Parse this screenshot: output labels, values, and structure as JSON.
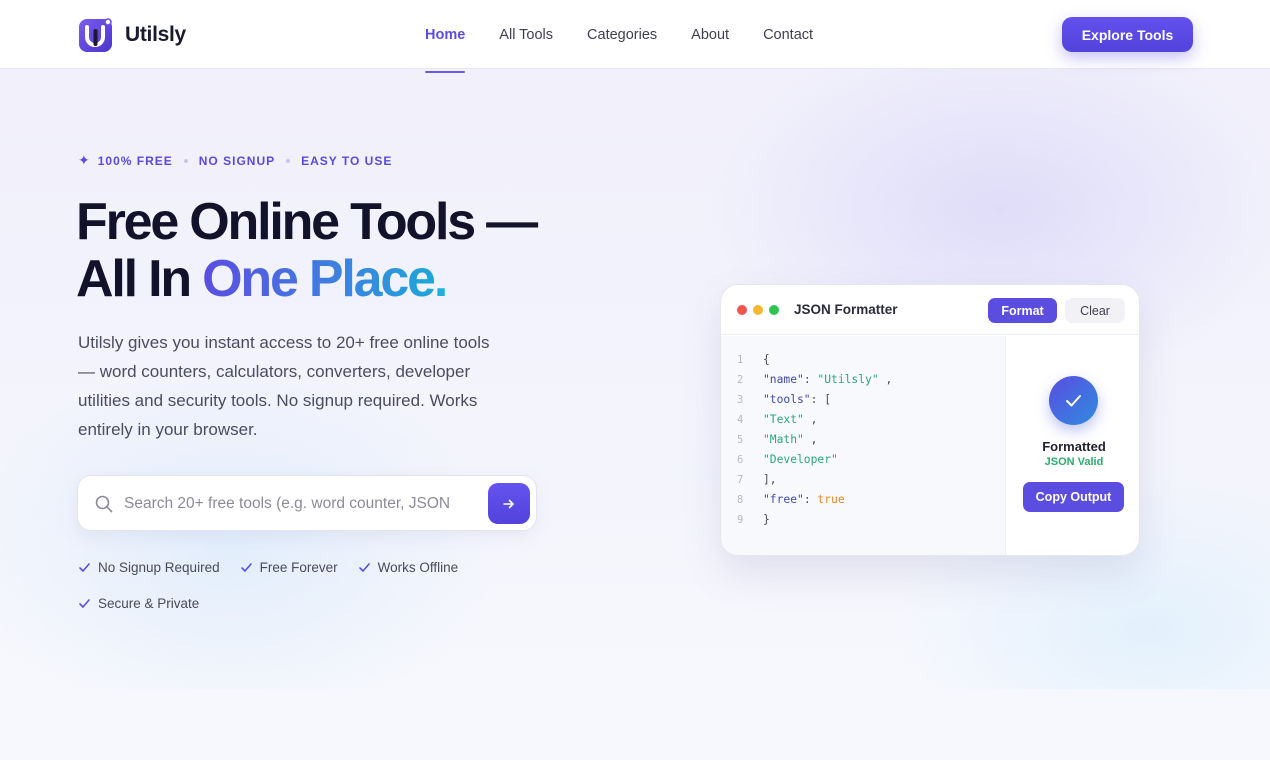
{
  "header": {
    "logo_text": "Utilsly",
    "nav": [
      {
        "label": "Home",
        "active": true
      },
      {
        "label": "All Tools"
      },
      {
        "label": "Categories"
      },
      {
        "label": "About"
      },
      {
        "label": "Contact"
      }
    ],
    "cta_label": "Explore Tools"
  },
  "hero": {
    "badges": [
      "100% FREE",
      "NO SIGNUP",
      "EASY TO USE"
    ],
    "title_line1": "Free Online Tools —",
    "title_line2_plain": "All In ",
    "title_line2_accent": "One Place",
    "title_line2_dot": ".",
    "lead": "Utilsly gives you instant access to 20+ free online tools — word counters, calculators, converters, developer utilities and security tools. No signup required. Works entirely in your browser.",
    "search_placeholder": "Search 20+ free tools (e.g. word counter, JSON",
    "features": [
      "No Signup Required",
      "Free Forever",
      "Works Offline",
      "Secure & Private"
    ]
  },
  "card": {
    "title": "JSON Formatter",
    "format_label": "Format",
    "clear_label": "Clear",
    "code_lines": [
      {
        "n": "1",
        "parts": [
          {
            "t": "{",
            "c": "p"
          }
        ]
      },
      {
        "n": "2",
        "parts": [
          {
            "t": "\"name\"",
            "c": "k"
          },
          {
            "t": ": ",
            "c": "p"
          },
          {
            "t": "\"Utilsly\"",
            "c": "s"
          },
          {
            "t": " ,",
            "c": "p"
          }
        ]
      },
      {
        "n": "3",
        "parts": [
          {
            "t": "\"tools\"",
            "c": "k"
          },
          {
            "t": ": [",
            "c": "p"
          }
        ]
      },
      {
        "n": "4",
        "parts": [
          {
            "t": "\"Text\"",
            "c": "s"
          },
          {
            "t": " ,",
            "c": "p"
          }
        ]
      },
      {
        "n": "5",
        "parts": [
          {
            "t": "\"Math\"",
            "c": "s"
          },
          {
            "t": " ,",
            "c": "p"
          }
        ]
      },
      {
        "n": "6",
        "parts": [
          {
            "t": "\"Developer\"",
            "c": "s"
          }
        ]
      },
      {
        "n": "7",
        "parts": [
          {
            "t": "],",
            "c": "p"
          }
        ]
      },
      {
        "n": "8",
        "parts": [
          {
            "t": "\"free\"",
            "c": "k"
          },
          {
            "t": ": ",
            "c": "p"
          },
          {
            "t": "true",
            "c": "b"
          }
        ]
      },
      {
        "n": "9",
        "parts": [
          {
            "t": "}",
            "c": "p"
          }
        ]
      }
    ],
    "status_label": "Formatted",
    "status_sub": "JSON Valid",
    "copy_label": "Copy Output"
  },
  "colors": {
    "brand": "#5b4de0",
    "accent_blue": "#1fb0da",
    "success": "#2eaa6e",
    "window_dots": [
      "#f2544e",
      "#f5b82e",
      "#2fc452"
    ]
  },
  "icons": {
    "logo": "logo-icon",
    "search": "search-icon",
    "go": "arrow-right-icon",
    "feature": "check-icon",
    "status": "check-circle-icon",
    "badge": "sparkle-icon"
  }
}
